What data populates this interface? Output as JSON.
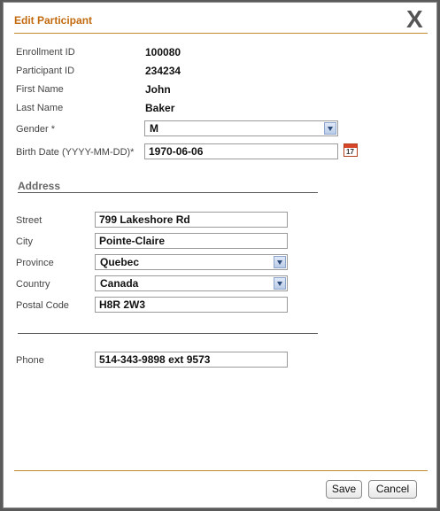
{
  "dialog": {
    "title": "Edit Participant",
    "close_label": "X"
  },
  "fields": {
    "enrollment_id_label": "Enrollment ID",
    "enrollment_id": "100080",
    "participant_id_label": "Participant ID",
    "participant_id": "234234",
    "first_name_label": "First Name",
    "first_name": "John",
    "last_name_label": "Last Name",
    "last_name": "Baker",
    "gender_label": "Gender *",
    "gender": "M",
    "birth_date_label": "Birth Date (YYYY-MM-DD)*",
    "birth_date": "1970-06-06",
    "calendar_day": "17"
  },
  "address": {
    "heading": "Address",
    "street_label": "Street",
    "street": "799  Lakeshore Rd",
    "city_label": "City",
    "city": "Pointe-Claire",
    "province_label": "Province",
    "province": "Quebec",
    "country_label": "Country",
    "country": "Canada",
    "postal_label": "Postal Code",
    "postal": "H8R 2W3"
  },
  "contact": {
    "phone_label": "Phone",
    "phone": "514-343-9898 ext 9573"
  },
  "buttons": {
    "save": "Save",
    "cancel": "Cancel"
  },
  "colors": {
    "title": "#c26a0e",
    "rule": "#c28a2e",
    "background": "#5a5a5a"
  }
}
